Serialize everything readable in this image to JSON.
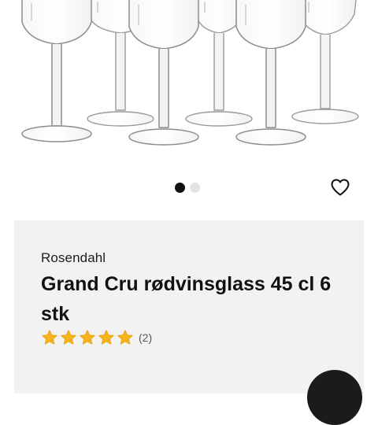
{
  "product": {
    "brand": "Rosendahl",
    "title": "Grand Cru rødvinsglass 45 cl 6 stk",
    "rating": 5,
    "max_rating": 5,
    "review_count_label": "(2)"
  },
  "carousel": {
    "slide_count": 2,
    "active_index": 0
  },
  "icons": {
    "wishlist": "heart-outline-icon",
    "star": "star-icon"
  },
  "colors": {
    "star": "#f6b21a",
    "card_background": "#f2f2f2",
    "dot_active": "#111111",
    "dot_inactive": "#e3e3e3",
    "text": "#111111"
  }
}
